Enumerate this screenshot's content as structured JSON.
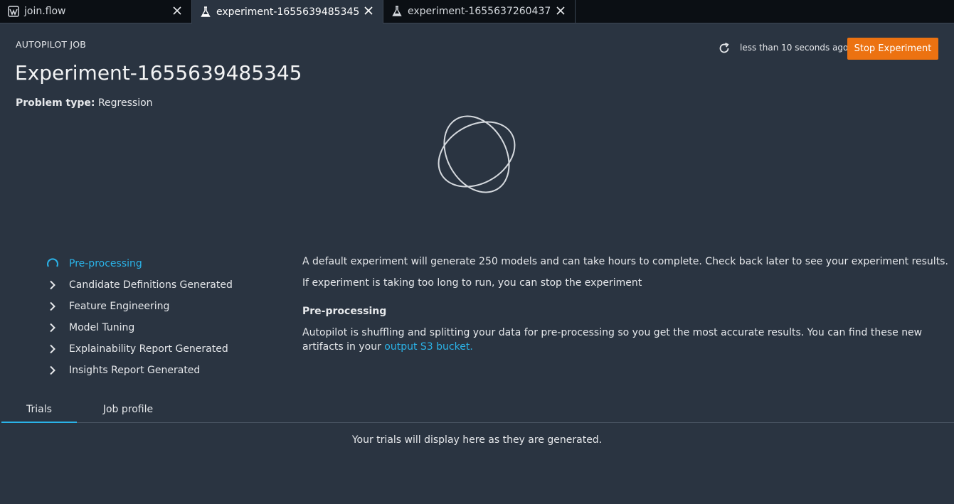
{
  "tabs": [
    {
      "label": "join.flow",
      "icon": "flow-icon"
    },
    {
      "label": "experiment-1655639485345",
      "icon": "flask-icon",
      "active": true
    },
    {
      "label": "experiment-1655637260437",
      "icon": "flask-icon"
    }
  ],
  "header": {
    "label": "AUTOPILOT JOB",
    "title": "Experiment-1655639485345",
    "problem_type_label": "Problem type:",
    "problem_type_value": "Regression",
    "last_updated": "less than 10 seconds ago",
    "stop_button": "Stop Experiment"
  },
  "steps": [
    {
      "label": "Pre-processing",
      "state": "in-progress"
    },
    {
      "label": "Candidate Definitions Generated",
      "state": "pending"
    },
    {
      "label": "Feature Engineering",
      "state": "pending"
    },
    {
      "label": "Model Tuning",
      "state": "pending"
    },
    {
      "label": "Explainability Report Generated",
      "state": "pending"
    },
    {
      "label": "Insights Report Generated",
      "state": "pending"
    }
  ],
  "description": {
    "line1": "A default experiment will generate 250 models and can take hours to complete. Check back later to see your experiment results.",
    "line2": "If experiment is taking too long to run, you can stop the experiment",
    "heading": "Pre-processing",
    "body_prefix": "Autopilot is shuffling and splitting your data for pre-processing so you get the most accurate results. You can find these new artifacts in your ",
    "link": "output S3 bucket."
  },
  "bottom_tabs": {
    "trials": "Trials",
    "job_profile": "Job profile"
  },
  "empty_message": "Your trials will display here as they are generated.",
  "colors": {
    "background": "#2a3441",
    "accent": "#2ab3e8",
    "stop_button": "#ec7211"
  }
}
